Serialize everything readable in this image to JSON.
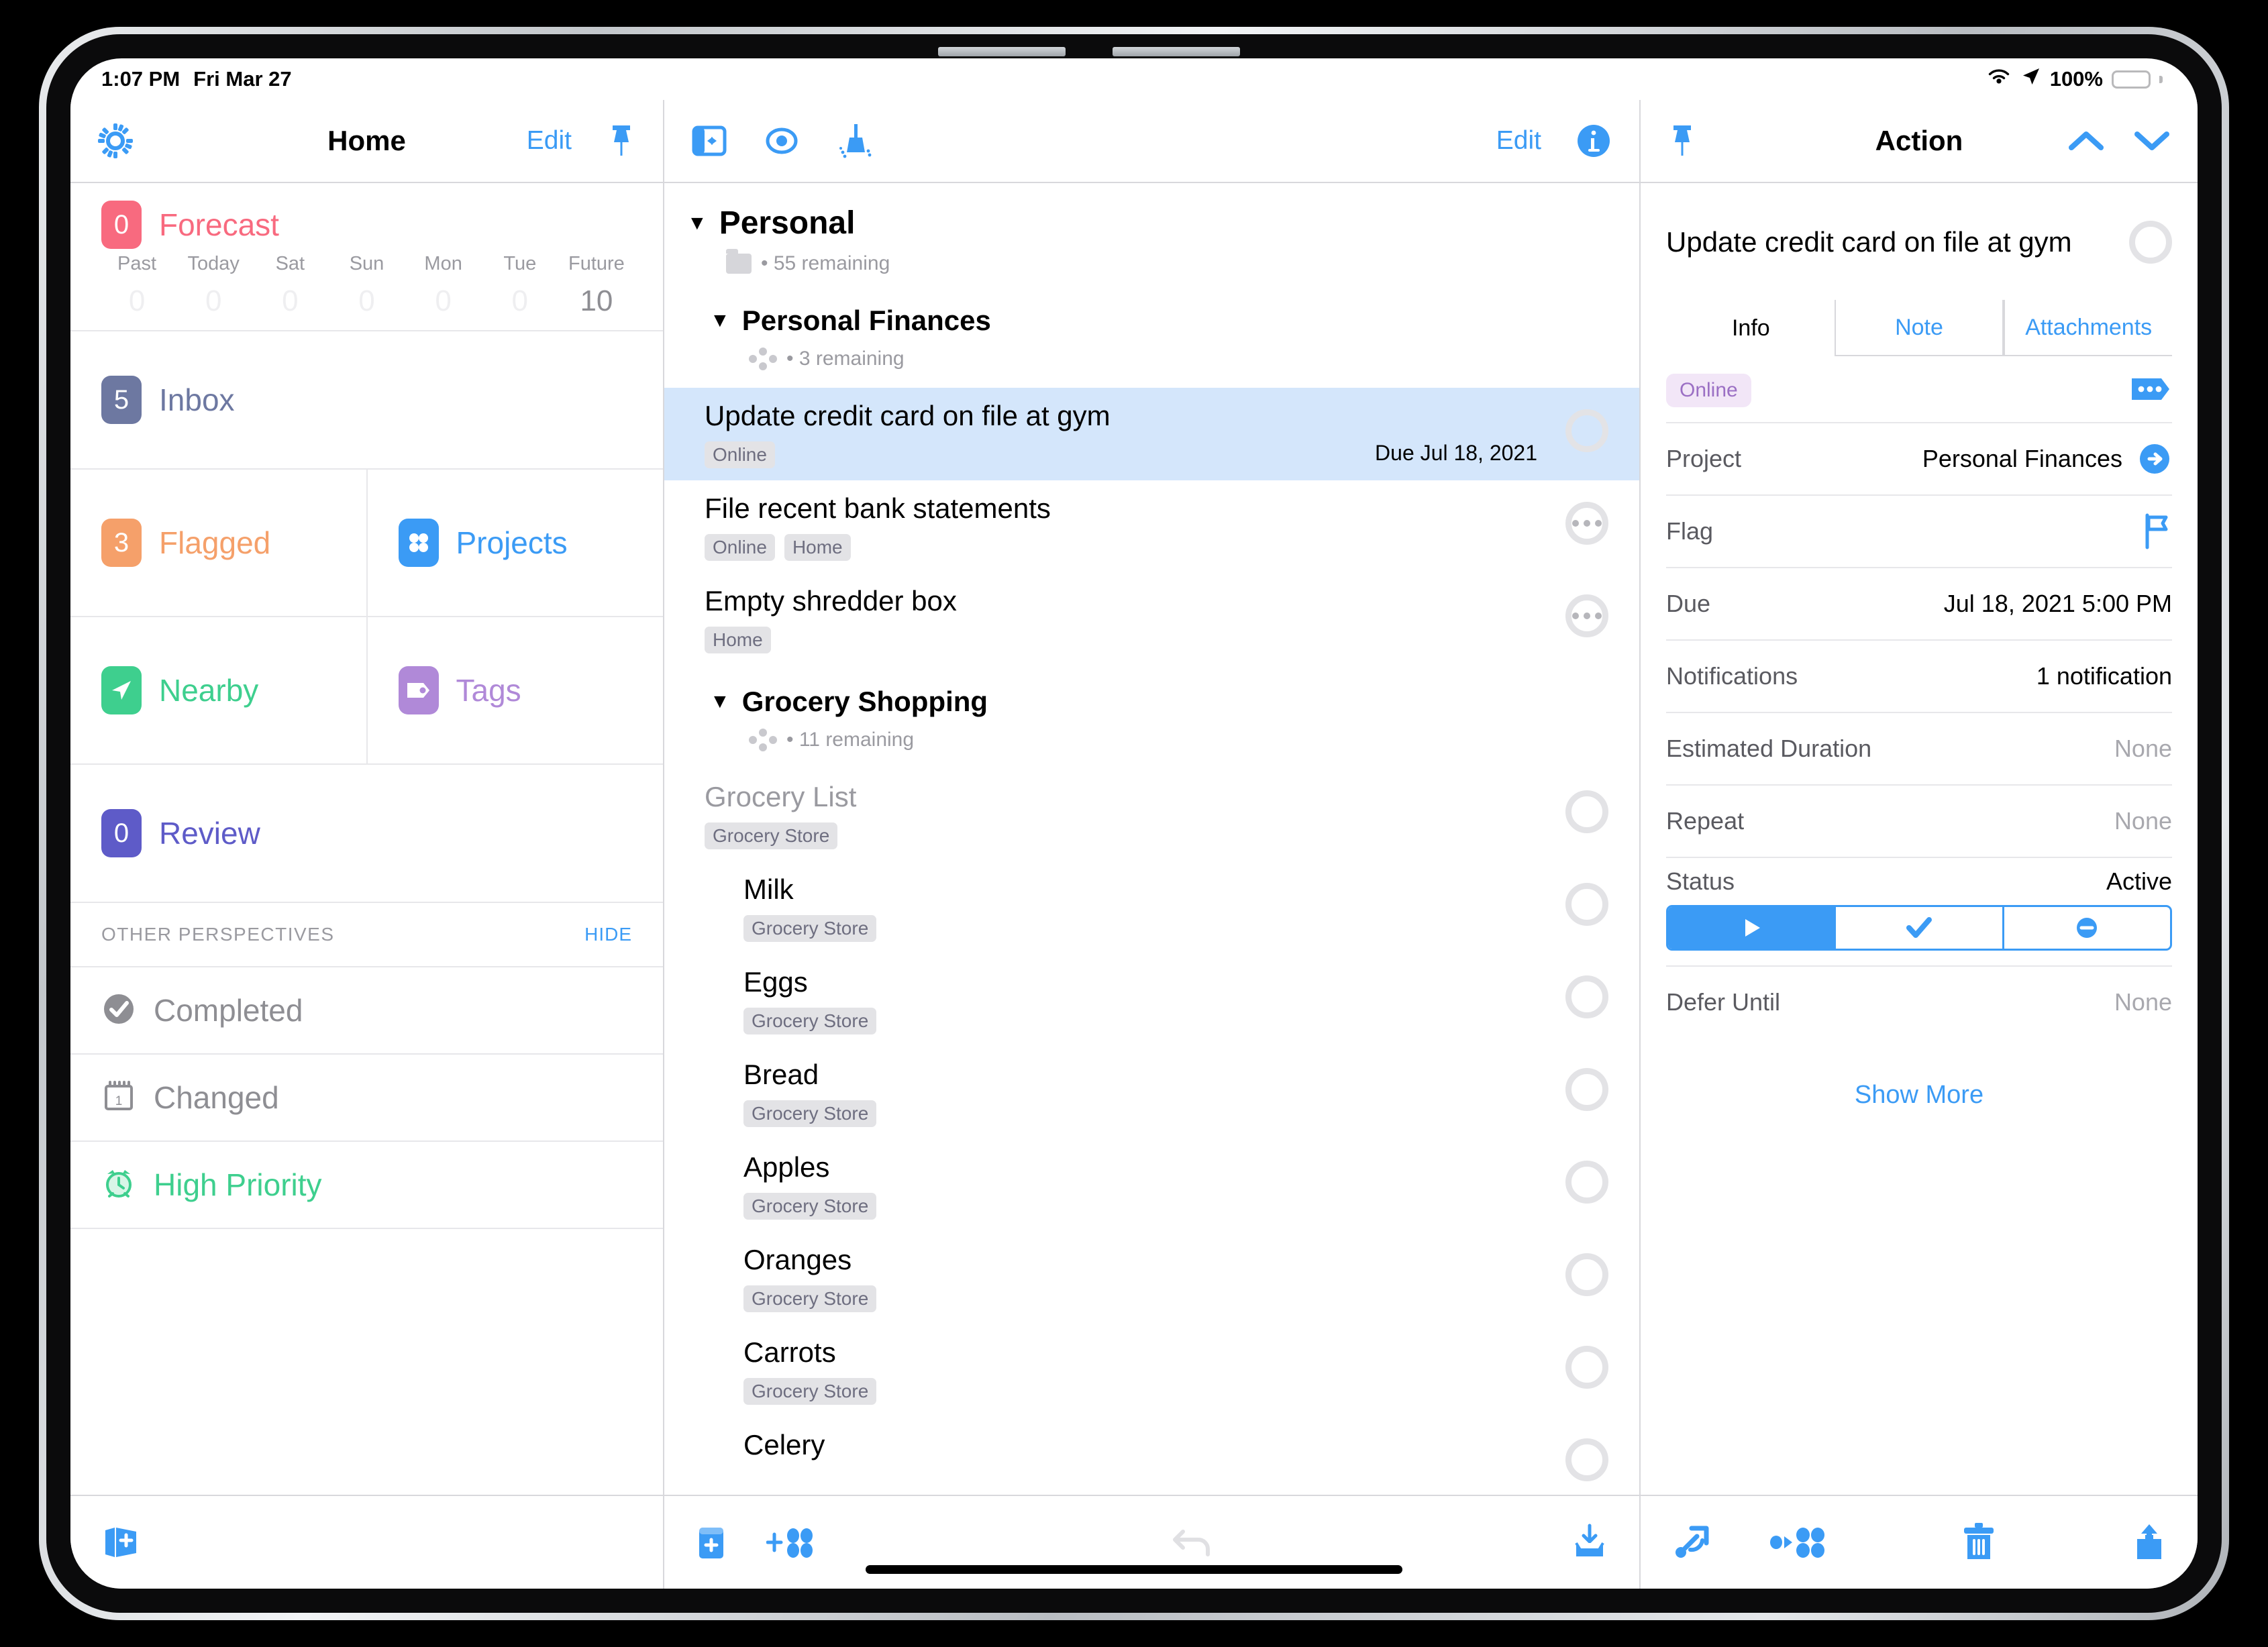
{
  "status_bar": {
    "time": "1:07 PM",
    "date": "Fri Mar 27",
    "battery_percent": "100%",
    "wifi_icon": "wifi-icon",
    "location_icon": "location-arrow-icon",
    "battery_icon": "battery-full-icon"
  },
  "sidebar": {
    "navbar": {
      "settings_icon": "gear-icon",
      "title": "Home",
      "edit_label": "Edit",
      "pin_icon": "pin-icon"
    },
    "forecast": {
      "count": "0",
      "label": "Forecast",
      "badge_color": "#f86a7f",
      "days": [
        {
          "name": "Past",
          "count": "0",
          "active": false
        },
        {
          "name": "Today",
          "count": "0",
          "active": false
        },
        {
          "name": "Sat",
          "count": "0",
          "active": false
        },
        {
          "name": "Sun",
          "count": "0",
          "active": false
        },
        {
          "name": "Mon",
          "count": "0",
          "active": false
        },
        {
          "name": "Tue",
          "count": "0",
          "active": false
        },
        {
          "name": "Future",
          "count": "10",
          "active": true
        }
      ]
    },
    "inbox": {
      "count": "5",
      "label": "Inbox",
      "badge_color": "#6d78a1",
      "text_color": "#6d78a1"
    },
    "flagged": {
      "count": "3",
      "label": "Flagged",
      "badge_color": "#f5a06a",
      "text_color": "#f5a06a"
    },
    "projects": {
      "label": "Projects",
      "badge_color": "#3b9bf5",
      "text_color": "#3b9bf5",
      "icon": "projects-dots-icon"
    },
    "nearby": {
      "label": "Nearby",
      "badge_color": "#3ecf8e",
      "text_color": "#3ecf8e",
      "icon": "location-arrow-icon"
    },
    "tags": {
      "label": "Tags",
      "badge_color": "#b089d8",
      "text_color": "#b089d8",
      "icon": "tag-icon"
    },
    "review": {
      "count": "0",
      "label": "Review",
      "badge_color": "#5e5bc8",
      "text_color": "#5e5bc8"
    },
    "other_header": {
      "title": "OTHER PERSPECTIVES",
      "action": "HIDE"
    },
    "other_items": [
      {
        "label": "Completed",
        "icon": "check-circle-icon",
        "color": "#8e8e93"
      },
      {
        "label": "Changed",
        "icon": "calendar-icon",
        "color": "#8e8e93"
      },
      {
        "label": "High Priority",
        "icon": "alarm-clock-icon",
        "color": "#3ecf8e"
      }
    ],
    "toolbar": {
      "add_perspective_icon": "add-perspective-icon"
    }
  },
  "list": {
    "navbar": {
      "sidebar_toggle_icon": "sidebar-toggle-icon",
      "view_icon": "eye-icon",
      "cleanup_icon": "broom-icon",
      "edit_label": "Edit",
      "info_icon": "info-circle-icon"
    },
    "groups": [
      {
        "title": "Personal",
        "level": 0,
        "meta_icon": "folder-icon",
        "meta": "• 55 remaining",
        "tasks": []
      },
      {
        "title": "Personal Finances",
        "level": 1,
        "meta_icon": "project-dots-icon",
        "meta": "• 3 remaining",
        "tasks": [
          {
            "title": "Update credit card on file at gym",
            "tags": [
              "Online"
            ],
            "due": "Due Jul 18, 2021",
            "selected": true,
            "status_icon": "empty-circle-icon",
            "indent": false,
            "dim": false
          },
          {
            "title": "File recent bank statements",
            "tags": [
              "Online",
              "Home"
            ],
            "due": "",
            "selected": false,
            "status_icon": "more-circle-icon",
            "indent": false,
            "dim": false
          },
          {
            "title": "Empty shredder box",
            "tags": [
              "Home"
            ],
            "due": "",
            "selected": false,
            "status_icon": "more-circle-icon",
            "indent": false,
            "dim": false
          }
        ]
      },
      {
        "title": "Grocery Shopping",
        "level": 1,
        "meta_icon": "project-dots-icon",
        "meta": "• 11 remaining",
        "tasks": [
          {
            "title": "Grocery List",
            "tags": [
              "Grocery Store"
            ],
            "due": "",
            "selected": false,
            "status_icon": "empty-circle-icon",
            "indent": false,
            "dim": true
          },
          {
            "title": "Milk",
            "tags": [
              "Grocery Store"
            ],
            "due": "",
            "selected": false,
            "status_icon": "empty-circle-icon",
            "indent": true,
            "dim": false
          },
          {
            "title": "Eggs",
            "tags": [
              "Grocery Store"
            ],
            "due": "",
            "selected": false,
            "status_icon": "empty-circle-icon",
            "indent": true,
            "dim": false
          },
          {
            "title": "Bread",
            "tags": [
              "Grocery Store"
            ],
            "due": "",
            "selected": false,
            "status_icon": "empty-circle-icon",
            "indent": true,
            "dim": false
          },
          {
            "title": "Apples",
            "tags": [
              "Grocery Store"
            ],
            "due": "",
            "selected": false,
            "status_icon": "empty-circle-icon",
            "indent": true,
            "dim": false
          },
          {
            "title": "Oranges",
            "tags": [
              "Grocery Store"
            ],
            "due": "",
            "selected": false,
            "status_icon": "empty-circle-icon",
            "indent": true,
            "dim": false
          },
          {
            "title": "Carrots",
            "tags": [
              "Grocery Store"
            ],
            "due": "",
            "selected": false,
            "status_icon": "empty-circle-icon",
            "indent": true,
            "dim": false
          },
          {
            "title": "Celery",
            "tags": [],
            "due": "",
            "selected": false,
            "status_icon": "empty-circle-icon",
            "indent": true,
            "dim": false
          }
        ]
      }
    ],
    "toolbar": {
      "new_project_icon": "new-project-icon",
      "new_action_icon": "new-action-icon",
      "undo_icon": "undo-icon",
      "inbox_icon": "add-to-inbox-icon"
    }
  },
  "inspector": {
    "navbar": {
      "pin_icon": "pin-icon",
      "title": "Action",
      "up_icon": "chevron-up-icon",
      "down_icon": "chevron-down-icon"
    },
    "task_title": "Update credit card on file at gym",
    "task_status_icon": "empty-circle-icon",
    "tabs": [
      {
        "label": "Info",
        "active": true
      },
      {
        "label": "Note",
        "active": false
      },
      {
        "label": "Attachments",
        "active": false
      }
    ],
    "tag": "Online",
    "tag_more_icon": "tag-more-icon",
    "rows": [
      {
        "label": "Project",
        "value": "Personal Finances",
        "icon": "arrow-right-circle-icon",
        "muted": false
      },
      {
        "label": "Flag",
        "value": "",
        "icon": "flag-icon",
        "muted": false
      },
      {
        "label": "Due",
        "value": "Jul 18, 2021  5:00 PM",
        "icon": "",
        "muted": false
      },
      {
        "label": "Notifications",
        "value": "1 notification",
        "icon": "",
        "muted": false
      },
      {
        "label": "Estimated Duration",
        "value": "None",
        "icon": "",
        "muted": true
      },
      {
        "label": "Repeat",
        "value": "None",
        "icon": "",
        "muted": true
      }
    ],
    "status": {
      "label": "Status",
      "value": "Active",
      "segments": [
        {
          "icon": "play-icon",
          "selected": true
        },
        {
          "icon": "check-icon",
          "selected": false
        },
        {
          "icon": "minus-circle-icon",
          "selected": false
        }
      ]
    },
    "defer": {
      "label": "Defer Until",
      "value": "None"
    },
    "show_more": "Show More",
    "toolbar": {
      "move_icon": "move-action-icon",
      "convert_icon": "convert-to-project-icon",
      "delete_icon": "trash-icon",
      "share_icon": "share-icon"
    }
  }
}
